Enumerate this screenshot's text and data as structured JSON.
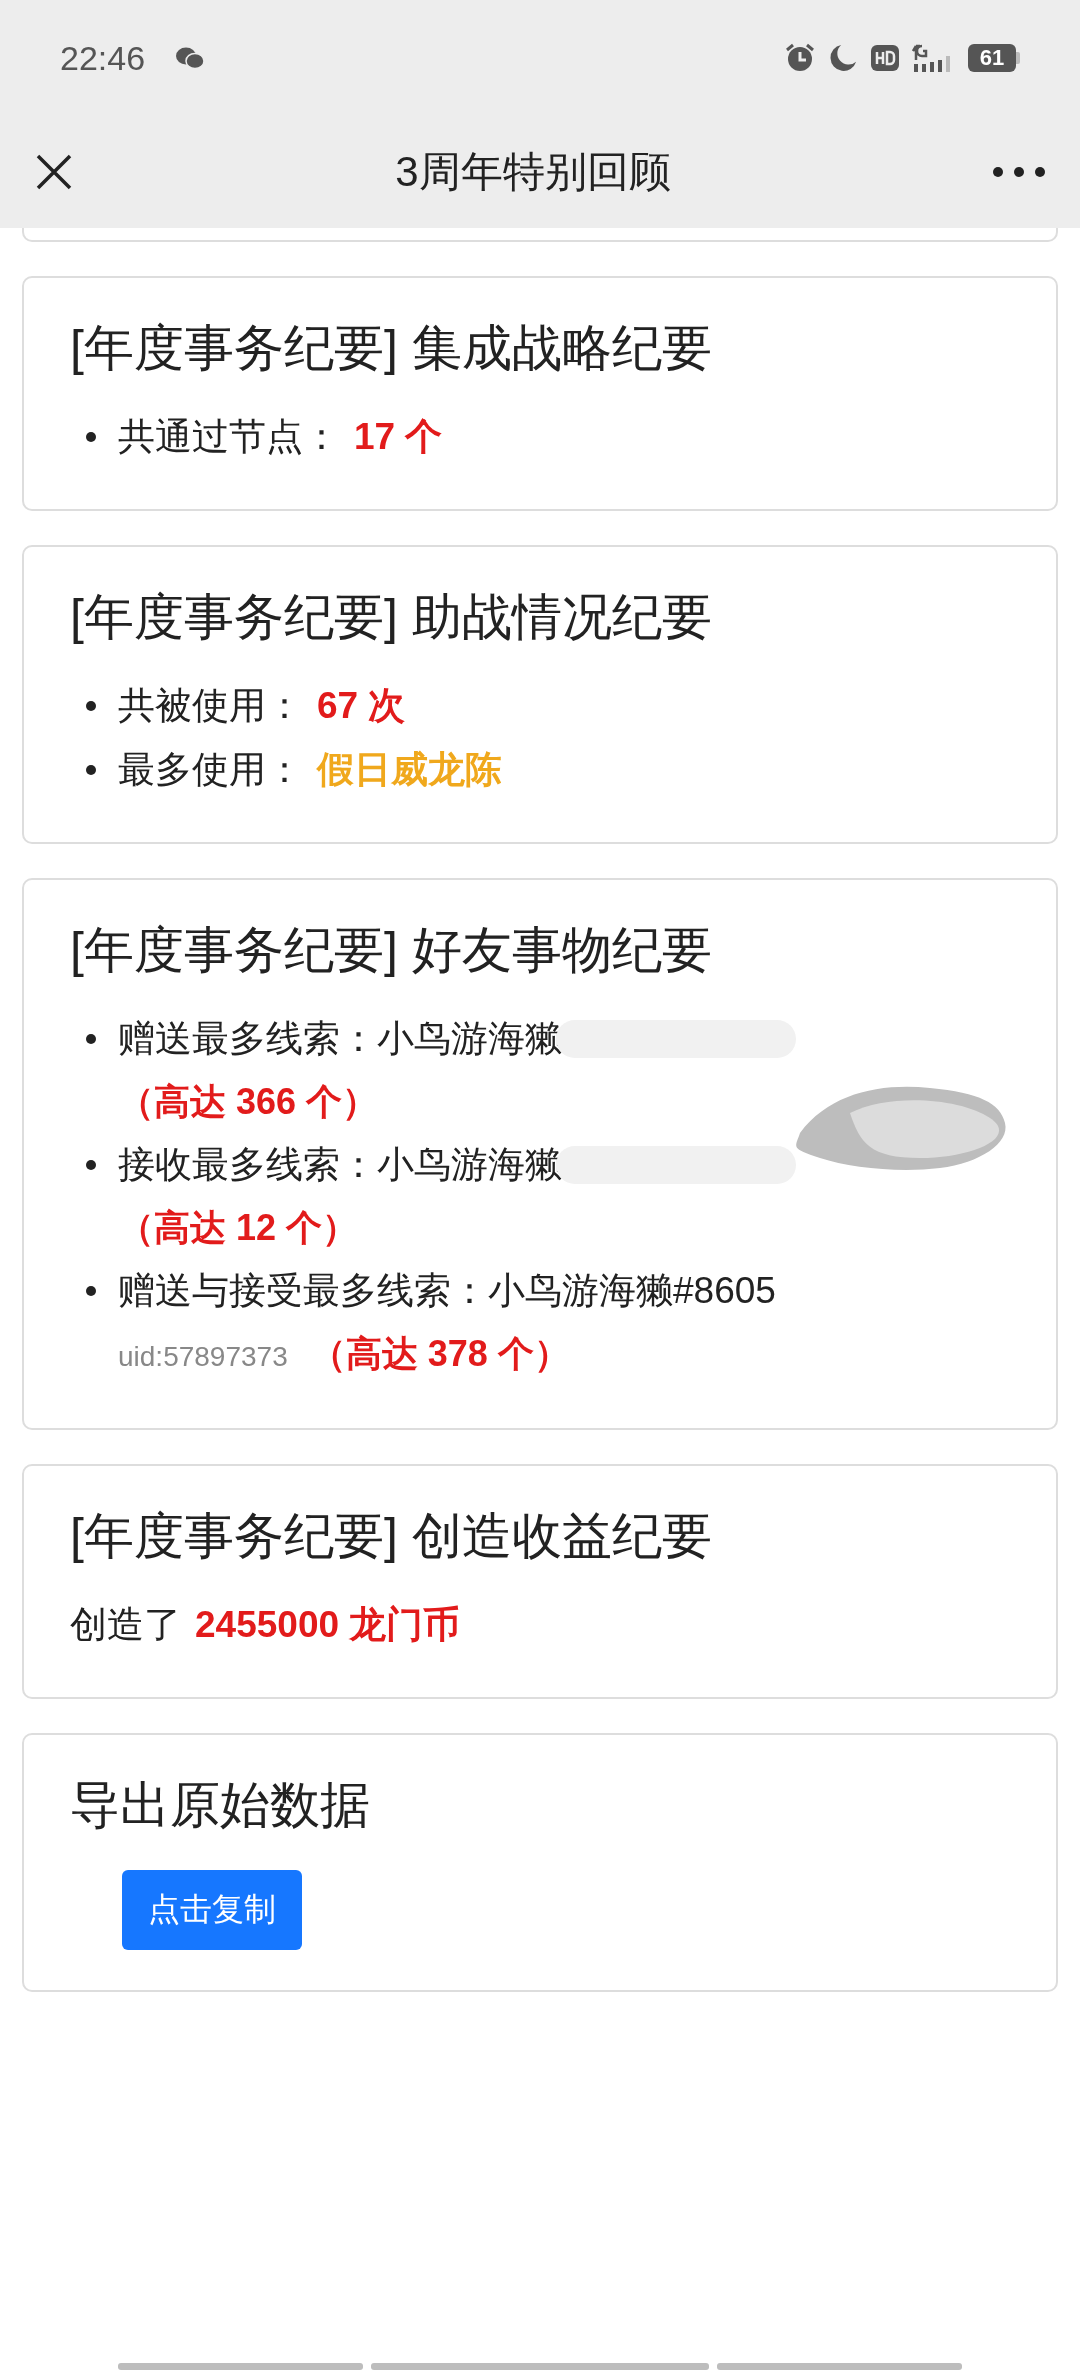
{
  "status_bar": {
    "time": "22:46",
    "battery": "61"
  },
  "nav": {
    "title": "3周年特别回顾"
  },
  "cards": [
    {
      "title": "[年度事务纪要] 集成战略纪要",
      "kind": "bullets",
      "items": [
        {
          "label": "共通过节点：",
          "value": "17 个",
          "color": "#e21b1b"
        }
      ]
    },
    {
      "title": "[年度事务纪要] 助战情况纪要",
      "kind": "bullets",
      "items": [
        {
          "label": "共被使用：",
          "value": "67 次",
          "color": "#e21b1b"
        },
        {
          "label": "最多使用：",
          "value": "假日威龙陈",
          "color": "#f0a81c"
        }
      ]
    },
    {
      "title": "[年度事务纪要] 好友事物纪要",
      "kind": "friends",
      "items": [
        {
          "label": "赠送最多线索：",
          "name": "小鸟游海獭",
          "redacted": true,
          "value": "（高达 366 个）",
          "color": "#e21b1b"
        },
        {
          "label": "接收最多线索：",
          "name": "小鸟游海獭",
          "redacted": true,
          "value": "（高达 12 个）",
          "color": "#e21b1b"
        },
        {
          "label": "赠送与接受最多线索：",
          "name": "小鸟游海獭#8605",
          "uid": "uid:57897373",
          "value": "（高达 378 个）",
          "color": "#e21b1b"
        }
      ]
    },
    {
      "title": "[年度事务纪要] 创造收益纪要",
      "kind": "sentence",
      "text": "创造了",
      "value": "2455000 龙门币",
      "color": "#e21b1b"
    },
    {
      "title": "导出原始数据",
      "kind": "button",
      "button": "点击复制"
    }
  ]
}
